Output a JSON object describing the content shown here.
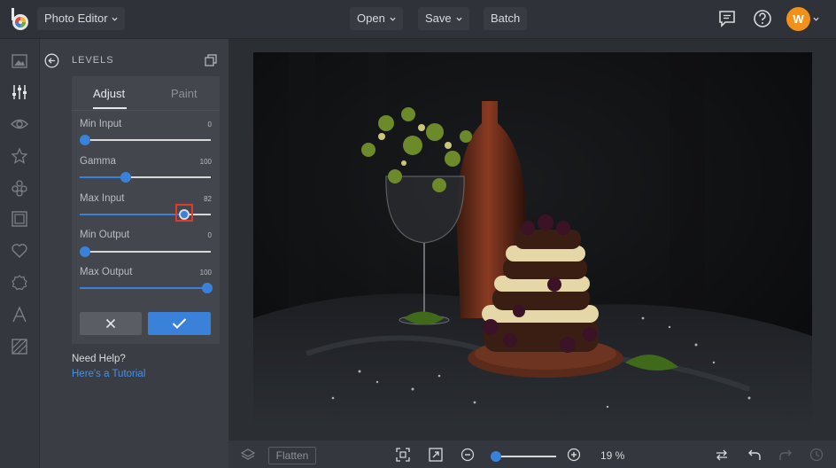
{
  "header": {
    "app_menu_label": "Photo Editor",
    "open_label": "Open",
    "save_label": "Save",
    "batch_label": "Batch",
    "avatar_initial": "W"
  },
  "sidebar": {
    "icons": [
      "image-icon",
      "sliders-icon",
      "eye-icon",
      "star-icon",
      "circles-icon",
      "frame-icon",
      "heart-icon",
      "badge-icon",
      "text-icon",
      "texture-icon"
    ],
    "active": "sliders-icon"
  },
  "panel": {
    "title": "LEVELS",
    "tabs": [
      "Adjust",
      "Paint"
    ],
    "active_tab": "Adjust",
    "sliders": [
      {
        "label": "Min Input",
        "value": "0",
        "level": 0.04
      },
      {
        "label": "Gamma",
        "value": "100",
        "level": 0.35
      },
      {
        "label": "Max Input",
        "value": "82",
        "level": 0.8
      },
      {
        "label": "Min Output",
        "value": "0",
        "level": 0.04
      },
      {
        "label": "Max Output",
        "value": "100",
        "level": 0.97
      }
    ],
    "help_title": "Need Help?",
    "help_link": "Here's a Tutorial"
  },
  "footer": {
    "flatten_label": "Flatten",
    "zoom_label": "19 %",
    "zoom_level": 0.05
  },
  "colors": {
    "accent": "#3a82d9",
    "avatar": "#f0911b",
    "highlight": "#e23b2e"
  }
}
